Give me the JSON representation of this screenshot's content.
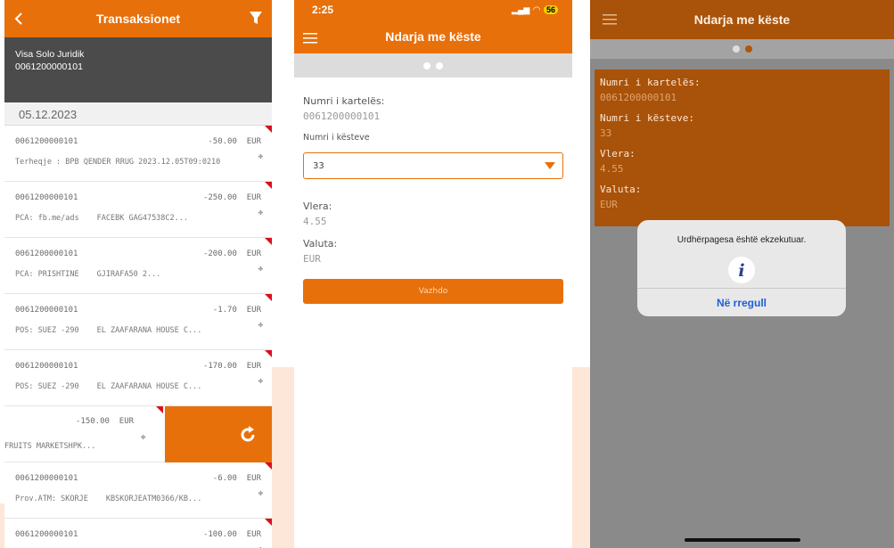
{
  "screen1": {
    "title": "Transaksionet",
    "account_name": "Visa Solo Juridik",
    "account_number": "0061200000101",
    "date": "05.12.2023",
    "transactions": [
      {
        "card": "0061200000101",
        "amount": "-50.00",
        "currency": "EUR",
        "desc1": "Terheqje : BPB QENDER RRUG 2023.12.05T09:0210",
        "desc2": ""
      },
      {
        "card": "0061200000101",
        "amount": "-250.00",
        "currency": "EUR",
        "desc1": "PCA: fb.me/ads",
        "desc2": "FACEBK GAG47538C2..."
      },
      {
        "card": "0061200000101",
        "amount": "-200.00",
        "currency": "EUR",
        "desc1": "PCA: PRISHTINE",
        "desc2": "GJIRAFA50            2..."
      },
      {
        "card": "0061200000101",
        "amount": "-1.70",
        "currency": "EUR",
        "desc1": "POS: SUEZ     -290",
        "desc2": "EL ZAAFARANA HOUSE C..."
      },
      {
        "card": "0061200000101",
        "amount": "-170.00",
        "currency": "EUR",
        "desc1": "POS: SUEZ     -290",
        "desc2": "EL ZAAFARANA HOUSE C..."
      }
    ],
    "swiped": {
      "amount": "-150.00",
      "currency": "EUR",
      "desc": "FRUITS MARKETSHPK..."
    },
    "transactions_after": [
      {
        "card": "0061200000101",
        "amount": "-6.00",
        "currency": "EUR",
        "desc1": "Prov.ATM: SKORJE",
        "desc2": "KBSKORJEATM0366/KB..."
      },
      {
        "card": "0061200000101",
        "amount": "-100.00",
        "currency": "EUR",
        "desc1": "",
        "desc2": ""
      }
    ]
  },
  "screen2": {
    "time": "2:25",
    "battery": "56",
    "title": "Ndarja me këste",
    "card_label": "Numri i kartelës:",
    "card_value": "0061200000101",
    "installments_label": "Numri i kësteve",
    "installments_value": "33",
    "amount_label": "Vlera:",
    "amount_value": "4.55",
    "currency_label": "Valuta:",
    "currency_value": "EUR",
    "continue_label": "Vazhdo"
  },
  "screen3": {
    "title": "Ndarja me këste",
    "card_label": "Numri i kartelës:",
    "card_value": "0061200000101",
    "installments_label": "Numri i kësteve:",
    "installments_value": "33",
    "amount_label": "Vlera:",
    "amount_value": "4.55",
    "currency_label": "Valuta:",
    "currency_value": "EUR",
    "alert_message": "Urdhërpagesa është ekzekutuar.",
    "alert_button": "Në rregull"
  },
  "colors": {
    "accent": "#e8700a",
    "alert_link": "#1d5fd6",
    "badge": "#d9101a"
  },
  "icons": [
    "back-icon",
    "filter-icon",
    "refresh-icon",
    "hamburger-icon",
    "dropdown-arrow-icon",
    "info-icon"
  ]
}
